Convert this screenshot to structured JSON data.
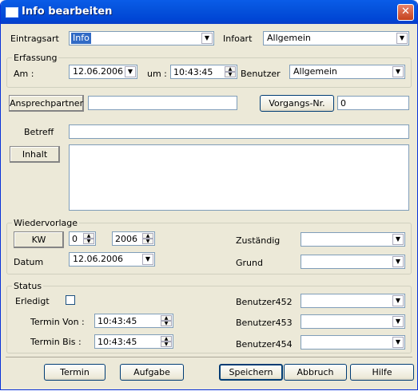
{
  "window": {
    "title": "Info bearbeiten",
    "close_glyph": "✕"
  },
  "header": {
    "eintragsart_label": "Eintragsart",
    "eintragsart_value": "Info",
    "infoart_label": "Infoart",
    "infoart_value": "Allgemein"
  },
  "erfassung": {
    "title": "Erfassung",
    "am_label": "Am :",
    "date_value": "12.06.2006",
    "um_label": "um :",
    "time_value": "10:43:45",
    "benutzer_label": "Benutzer",
    "benutzer_value": "Allgemein"
  },
  "contact": {
    "ansprechpartner_button": "Ansprechpartner",
    "ansprechpartner_value": "",
    "vorgangs_button": "Vorgangs-Nr.",
    "vorgangs_value": "0"
  },
  "betreff": {
    "label": "Betreff",
    "value": ""
  },
  "inhalt": {
    "button": "Inhalt",
    "value": ""
  },
  "wiedervorlage": {
    "title": "Wiedervorlage",
    "kw_button": "KW",
    "kw_value": "0",
    "year_value": "2006",
    "datum_label": "Datum",
    "datum_value": "12.06.2006",
    "zustaendig_label": "Zuständig",
    "zustaendig_value": "",
    "grund_label": "Grund",
    "grund_value": ""
  },
  "status": {
    "title": "Status",
    "erledigt_label": "Erledigt",
    "erledigt_checked": false,
    "termin_von_label": "Termin Von :",
    "termin_von_value": "10:43:45",
    "termin_bis_label": "Termin Bis :",
    "termin_bis_value": "10:43:45",
    "b452_label": "Benutzer452",
    "b452_value": "",
    "b453_label": "Benutzer453",
    "b453_value": "",
    "b454_label": "Benutzer454",
    "b454_value": ""
  },
  "footer": {
    "termin": "Termin",
    "aufgabe": "Aufgabe",
    "speichern": "Speichern",
    "abbruch": "Abbruch",
    "hilfe": "Hilfe"
  },
  "icons": {
    "dropdown": "▼",
    "spin_up": "▲",
    "spin_down": "▼"
  },
  "colors": {
    "title_bar": "#0054e3",
    "selection": "#316ac5",
    "dialog_bg": "#ece9d8"
  }
}
